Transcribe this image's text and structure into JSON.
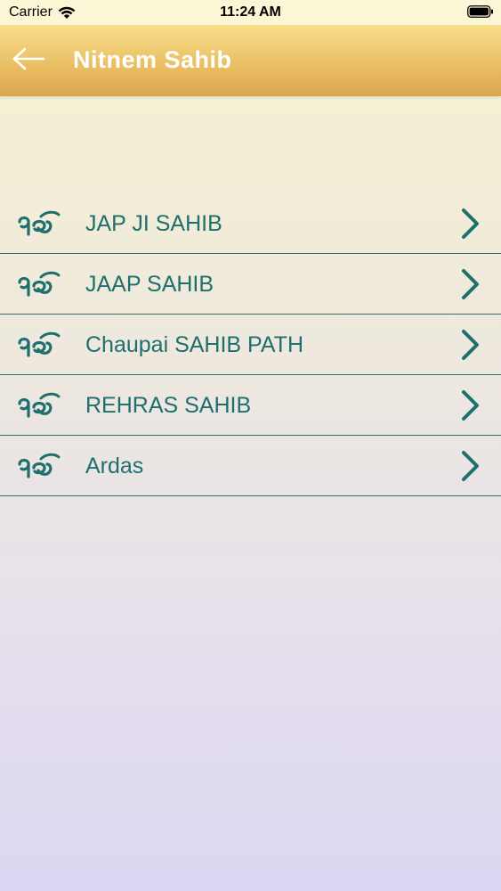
{
  "status_bar": {
    "carrier": "Carrier",
    "time": "11:24 AM"
  },
  "header": {
    "title": "Nitnem Sahib",
    "back_icon": "arrow-left-icon"
  },
  "list": {
    "icon": "ek-onkar-icon",
    "items": [
      {
        "label": "JAP JI SAHIB"
      },
      {
        "label": "JAAP SAHIB"
      },
      {
        "label": "Chaupai SAHIB PATH"
      },
      {
        "label": "REHRAS SAHIB"
      },
      {
        "label": "Ardas"
      }
    ]
  },
  "colors": {
    "accent_text": "#1f6f6e",
    "divider": "#2f6f6c",
    "header_top": "#f7df8a",
    "header_bottom": "#d9a551"
  }
}
